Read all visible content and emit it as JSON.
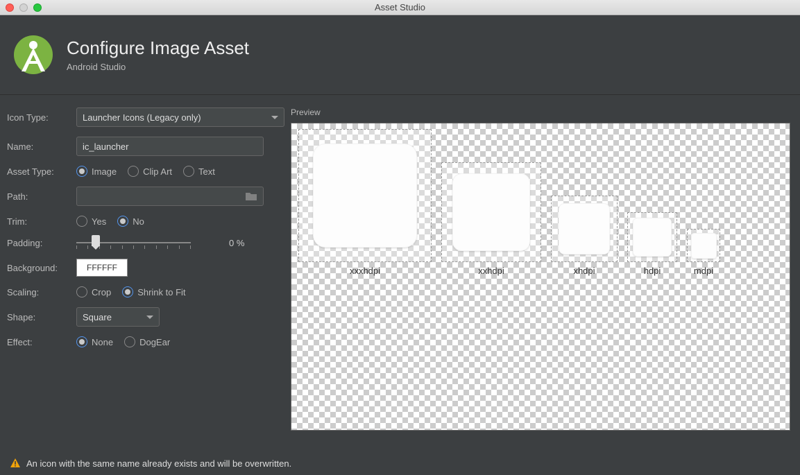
{
  "window": {
    "title": "Asset Studio"
  },
  "header": {
    "title": "Configure Image Asset",
    "subtitle": "Android Studio"
  },
  "form": {
    "iconTypeLabel": "Icon Type:",
    "iconTypeValue": "Launcher Icons (Legacy only)",
    "nameLabel": "Name:",
    "nameValue": "ic_launcher",
    "assetTypeLabel": "Asset Type:",
    "assetType": {
      "image": "Image",
      "clipArt": "Clip Art",
      "text": "Text"
    },
    "pathLabel": "Path:",
    "pathValue": "",
    "trimLabel": "Trim:",
    "trim": {
      "yes": "Yes",
      "no": "No"
    },
    "paddingLabel": "Padding:",
    "paddingValue": "0 %",
    "backgroundLabel": "Background:",
    "backgroundValue": "FFFFFF",
    "scalingLabel": "Scaling:",
    "scaling": {
      "crop": "Crop",
      "shrink": "Shrink to Fit"
    },
    "shapeLabel": "Shape:",
    "shapeValue": "Square",
    "effectLabel": "Effect:",
    "effect": {
      "none": "None",
      "dogEar": "DogEar"
    }
  },
  "preview": {
    "label": "Preview",
    "sizes": [
      {
        "name": "xxxhdpi",
        "box": 192,
        "icon": 150
      },
      {
        "name": "xxhdpi",
        "box": 144,
        "icon": 112
      },
      {
        "name": "xhdpi",
        "box": 96,
        "icon": 74
      },
      {
        "name": "hdpi",
        "box": 72,
        "icon": 56
      },
      {
        "name": "mdpi",
        "box": 48,
        "icon": 37
      }
    ]
  },
  "footer": {
    "warning": "An icon with the same name already exists and will be overwritten."
  }
}
